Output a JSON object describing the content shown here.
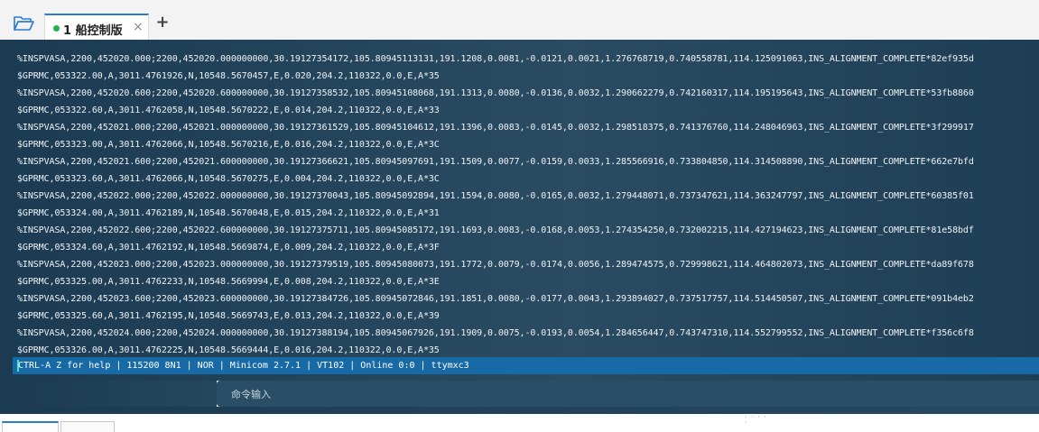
{
  "tabs": [
    {
      "label": "1 船控制版",
      "close": "×",
      "active": true
    }
  ],
  "new_tab_label": "+",
  "terminal": {
    "lines": [
      "%INSPVASA,2200,452020.000;2200,452020.000000000,30.19127354172,105.80945113131,191.1208,0.0081,-0.0121,0.0021,1.276768719,0.740558781,114.125091063,INS_ALIGNMENT_COMPLETE*82ef935d",
      "$GPRMC,053322.00,A,3011.4761926,N,10548.5670457,E,0.020,204.2,110322,0.0,E,A*35",
      "%INSPVASA,2200,452020.600;2200,452020.600000000,30.19127358532,105.80945108068,191.1313,0.0080,-0.0136,0.0032,1.290662279,0.742160317,114.195195643,INS_ALIGNMENT_COMPLETE*53fb8860",
      "$GPRMC,053322.60,A,3011.4762058,N,10548.5670222,E,0.014,204.2,110322,0.0,E,A*33",
      "%INSPVASA,2200,452021.000;2200,452021.000000000,30.19127361529,105.80945104612,191.1396,0.0083,-0.0145,0.0032,1.298518375,0.741376760,114.248046963,INS_ALIGNMENT_COMPLETE*3f299917",
      "$GPRMC,053323.00,A,3011.4762066,N,10548.5670216,E,0.016,204.2,110322,0.0,E,A*3C",
      "%INSPVASA,2200,452021.600;2200,452021.600000000,30.19127366621,105.80945097691,191.1509,0.0077,-0.0159,0.0033,1.285566916,0.733804850,114.314508890,INS_ALIGNMENT_COMPLETE*662e7bfd",
      "$GPRMC,053323.60,A,3011.4762066,N,10548.5670275,E,0.004,204.2,110322,0.0,E,A*3C",
      "%INSPVASA,2200,452022.000;2200,452022.000000000,30.19127370043,105.80945092894,191.1594,0.0080,-0.0165,0.0032,1.279448071,0.737347621,114.363247797,INS_ALIGNMENT_COMPLETE*60385f01",
      "$GPRMC,053324.00,A,3011.4762189,N,10548.5670048,E,0.015,204.2,110322,0.0,E,A*31",
      "%INSPVASA,2200,452022.600;2200,452022.600000000,30.19127375711,105.80945085172,191.1693,0.0083,-0.0168,0.0053,1.274354250,0.732002215,114.427194623,INS_ALIGNMENT_COMPLETE*81e58bdf",
      "$GPRMC,053324.60,A,3011.4762192,N,10548.5669874,E,0.009,204.2,110322,0.0,E,A*3F",
      "%INSPVASA,2200,452023.000;2200,452023.000000000,30.19127379519,105.80945080073,191.1772,0.0079,-0.0174,0.0056,1.289474575,0.729998621,114.464802073,INS_ALIGNMENT_COMPLETE*da89f678",
      "$GPRMC,053325.00,A,3011.4762233,N,10548.5669994,E,0.008,204.2,110322,0.0,E,A*3E",
      "%INSPVASA,2200,452023.600;2200,452023.600000000,30.19127384726,105.80945072846,191.1851,0.0080,-0.0177,0.0043,1.293894027,0.737517757,114.514450507,INS_ALIGNMENT_COMPLETE*091b4eb2",
      "$GPRMC,053325.60,A,3011.4762195,N,10548.5669743,E,0.013,204.2,110322,0.0,E,A*39",
      "%INSPVASA,2200,452024.000;2200,452024.000000000,30.19127388194,105.80945067926,191.1909,0.0075,-0.0193,0.0054,1.284656447,0.743747310,114.552799552,INS_ALIGNMENT_COMPLETE*f356c6f8",
      "$GPRMC,053326.00,A,3011.4762225,N,10548.5669444,E,0.016,204.2,110322,0.0,E,A*35"
    ],
    "status": "CTRL-A Z for help | 115200 8N1 | NOR | Minicom 2.7.1 | VT102 | Online 0:0 | ttymxc3"
  },
  "command": {
    "placeholder": "命令输入"
  },
  "colors": {
    "accent": "#2b7bd6",
    "terminal_bg": "#1f3e55",
    "status_bar": "#176aa6",
    "tab_dot": "#22b24c"
  },
  "icons": [
    "folder-open-icon",
    "close-icon",
    "plus-icon"
  ]
}
